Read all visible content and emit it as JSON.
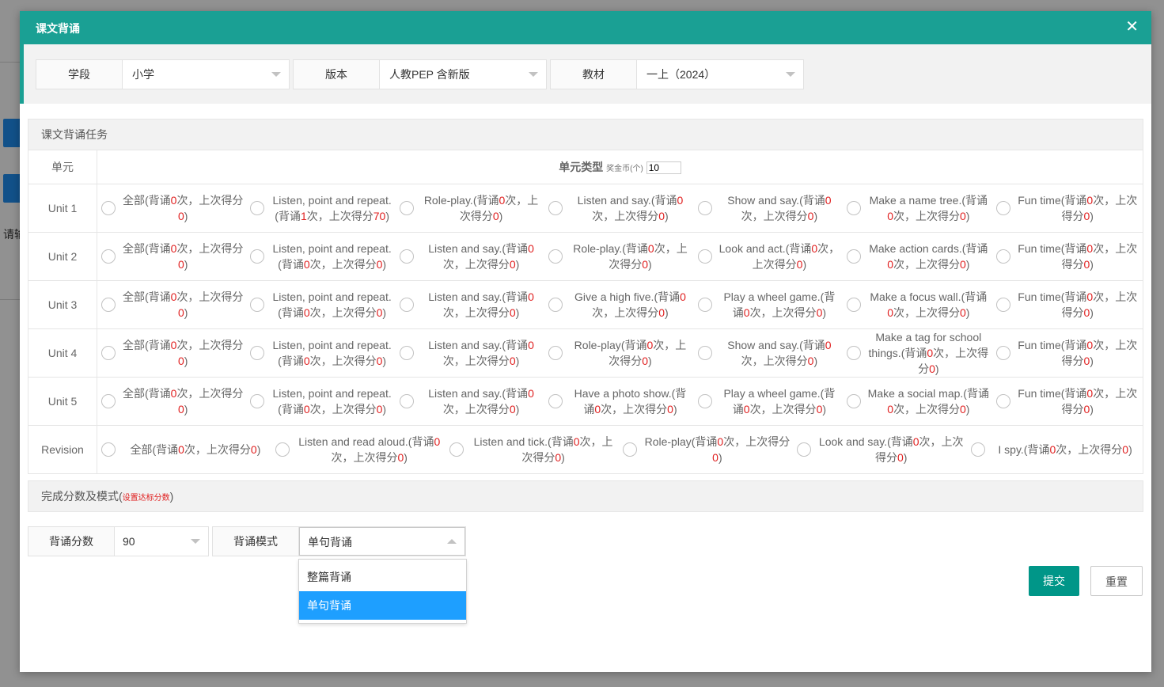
{
  "background": {
    "partial_text": "请输"
  },
  "dialog": {
    "title": "课文背诵",
    "close_glyph": "✕"
  },
  "filters": [
    {
      "label": "学段",
      "value": "小学"
    },
    {
      "label": "版本",
      "value": "人教PEP 含新版"
    },
    {
      "label": "教材",
      "value": "一上（2024）"
    }
  ],
  "task_section": {
    "title": "课文背诵任务",
    "unit_header": "单元",
    "type_header": "单元类型",
    "coin_label": "奖金币(个)",
    "coin_value": "10"
  },
  "units": [
    {
      "name": "Unit 1",
      "options": [
        {
          "title": "全部",
          "count": "0",
          "score": "0"
        },
        {
          "title": "Listen, point and repeat.",
          "count": "1",
          "score": "70"
        },
        {
          "title": "Role-play.",
          "count": "0",
          "score": "0"
        },
        {
          "title": "Listen and say.",
          "count": "0",
          "score": "0"
        },
        {
          "title": "Show and say.",
          "count": "0",
          "score": "0"
        },
        {
          "title": "Make a name tree.",
          "count": "0",
          "score": "0"
        },
        {
          "title": "Fun time",
          "count": "0",
          "score": "0"
        }
      ]
    },
    {
      "name": "Unit 2",
      "options": [
        {
          "title": "全部",
          "count": "0",
          "score": "0"
        },
        {
          "title": "Listen, point and repeat.",
          "count": "0",
          "score": "0"
        },
        {
          "title": "Listen and say.",
          "count": "0",
          "score": "0"
        },
        {
          "title": "Role-play.",
          "count": "0",
          "score": "0"
        },
        {
          "title": "Look and act.",
          "count": "0",
          "score": "0"
        },
        {
          "title": "Make action cards.",
          "count": "0",
          "score": "0"
        },
        {
          "title": "Fun time",
          "count": "0",
          "score": "0"
        }
      ]
    },
    {
      "name": "Unit 3",
      "options": [
        {
          "title": "全部",
          "count": "0",
          "score": "0"
        },
        {
          "title": "Listen, point and repeat.",
          "count": "0",
          "score": "0"
        },
        {
          "title": "Listen and say.",
          "count": "0",
          "score": "0"
        },
        {
          "title": "Give a high five.",
          "count": "0",
          "score": "0"
        },
        {
          "title": "Play a wheel game.",
          "count": "0",
          "score": "0"
        },
        {
          "title": "Make a focus wall.",
          "count": "0",
          "score": "0"
        },
        {
          "title": "Fun time",
          "count": "0",
          "score": "0"
        }
      ]
    },
    {
      "name": "Unit 4",
      "options": [
        {
          "title": "全部",
          "count": "0",
          "score": "0"
        },
        {
          "title": "Listen, point and repeat.",
          "count": "0",
          "score": "0"
        },
        {
          "title": "Listen and say.",
          "count": "0",
          "score": "0"
        },
        {
          "title": "Role-play",
          "count": "0",
          "score": "0"
        },
        {
          "title": "Show and say.",
          "count": "0",
          "score": "0"
        },
        {
          "title": "Make a tag for school things.",
          "count": "0",
          "score": "0"
        },
        {
          "title": "Fun time",
          "count": "0",
          "score": "0"
        }
      ]
    },
    {
      "name": "Unit 5",
      "options": [
        {
          "title": "全部",
          "count": "0",
          "score": "0"
        },
        {
          "title": "Listen, point and repeat.",
          "count": "0",
          "score": "0"
        },
        {
          "title": "Listen and say.",
          "count": "0",
          "score": "0"
        },
        {
          "title": "Have a photo show.",
          "count": "0",
          "score": "0"
        },
        {
          "title": "Play a wheel game.",
          "count": "0",
          "score": "0"
        },
        {
          "title": "Make a social map.",
          "count": "0",
          "score": "0"
        },
        {
          "title": "Fun time",
          "count": "0",
          "score": "0"
        }
      ]
    },
    {
      "name": "Revision",
      "options": [
        {
          "title": "全部",
          "count": "0",
          "score": "0"
        },
        {
          "title": "Listen and read aloud.",
          "count": "0",
          "score": "0"
        },
        {
          "title": "Listen and tick.",
          "count": "0",
          "score": "0"
        },
        {
          "title": "Role-play",
          "count": "0",
          "score": "0"
        },
        {
          "title": "Look and say.",
          "count": "0",
          "score": "0"
        },
        {
          "title": "I spy.",
          "count": "0",
          "score": "0"
        }
      ]
    }
  ],
  "option_text": {
    "open": "(背诵",
    "mid": "次，上次得分",
    "close": ")"
  },
  "score_section": {
    "title": "完成分数及模式",
    "hint": "设置达标分数",
    "score_label": "背诵分数",
    "score_value": "90",
    "mode_label": "背诵模式",
    "mode_value": "单句背诵",
    "mode_options": [
      "整篇背诵",
      "单句背诵"
    ],
    "mode_selected_index": 1
  },
  "buttons": {
    "submit": "提交",
    "reset": "重置"
  },
  "colors": {
    "header": "#1aa094",
    "submit": "#009688",
    "highlight": "#1e9fff",
    "number": "#e02020"
  }
}
